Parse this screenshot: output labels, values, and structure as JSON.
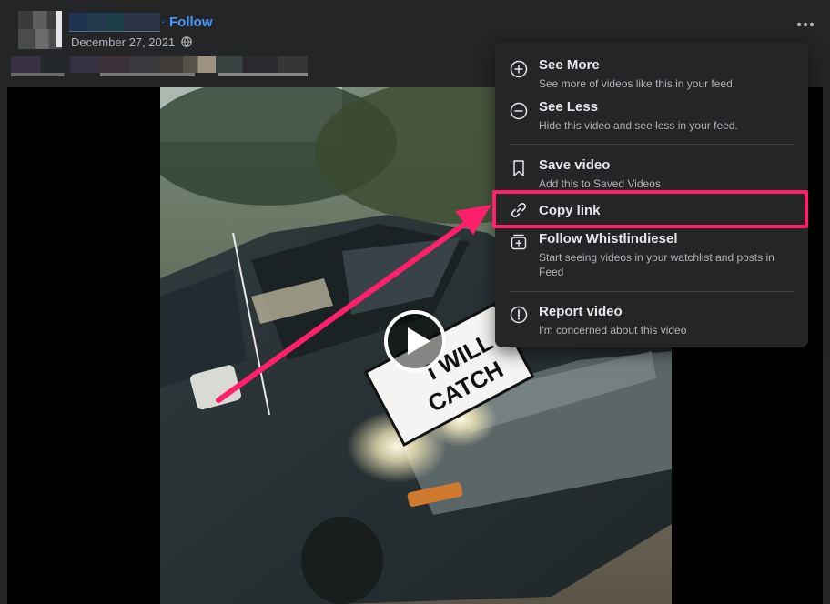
{
  "post": {
    "follow_separator": "·",
    "follow_label": "Follow",
    "date": "December 27, 2021"
  },
  "video": {
    "sign_line1": "I WILL",
    "sign_line2": "CATCH"
  },
  "menu": {
    "items": [
      {
        "title": "See More",
        "description": "See more of videos like this in your feed.",
        "icon": "plus-circle-icon"
      },
      {
        "title": "See Less",
        "description": "Hide this video and see less in your feed.",
        "icon": "minus-circle-icon"
      },
      {
        "title": "Save video",
        "description": "Add this to Saved Videos",
        "icon": "bookmark-icon"
      },
      {
        "title": "Copy link",
        "description": "",
        "icon": "link-icon"
      },
      {
        "title": "Follow Whistlindiesel",
        "description": "Start seeing videos in your watchlist and posts in Feed",
        "icon": "watchlist-plus-icon"
      },
      {
        "title": "Report video",
        "description": "I'm concerned about this video",
        "icon": "alert-circle-icon"
      }
    ]
  },
  "colors": {
    "background": "#242526",
    "link": "#4599ff",
    "primary_text": "#e4e6eb",
    "secondary_text": "#b0b3b8",
    "annotation": "#ff1f6b"
  }
}
